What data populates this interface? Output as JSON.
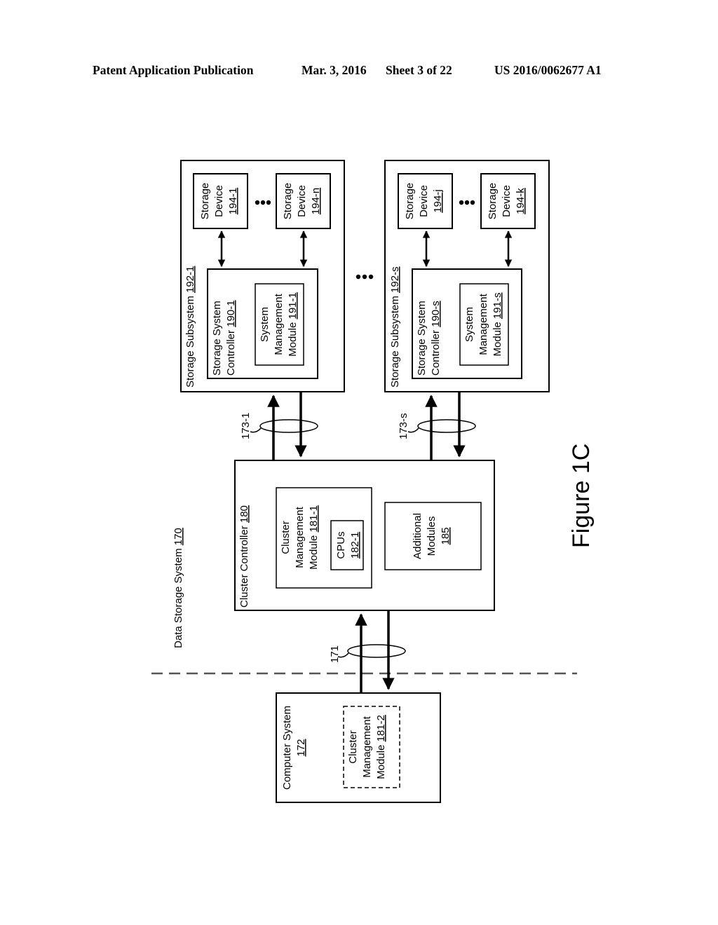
{
  "header": {
    "publication": "Patent Application Publication",
    "date": "Mar. 3, 2016",
    "sheet": "Sheet 3 of 22",
    "number": "US 2016/0062677 A1"
  },
  "figure_label": "Figure 1C",
  "system": {
    "label": "Data Storage System ",
    "ref": "170"
  },
  "subsystems": [
    {
      "label": "Storage Subsystem ",
      "ref": "192-1",
      "controller": {
        "line1": "Storage System",
        "line2": "Controller ",
        "ref": "190-1"
      },
      "module": {
        "line1": "System",
        "line2": "Management",
        "line3": "Module ",
        "ref": "191-1"
      },
      "devices": [
        {
          "line1": "Storage",
          "line2": "Device",
          "ref": "194-1"
        },
        {
          "line1": "Storage",
          "line2": "Device",
          "ref": "194-n"
        }
      ],
      "link": "173-1"
    },
    {
      "label": "Storage Subsystem ",
      "ref": "192-s",
      "controller": {
        "line1": "Storage System",
        "line2": "Controller ",
        "ref": "190-s"
      },
      "module": {
        "line1": "System",
        "line2": "Management",
        "line3": "Module ",
        "ref": "191-s"
      },
      "devices": [
        {
          "line1": "Storage",
          "line2": "Device",
          "ref": "194-j"
        },
        {
          "line1": "Storage",
          "line2": "Device",
          "ref": "194-k"
        }
      ],
      "link": "173-s"
    }
  ],
  "cluster_controller": {
    "label": "Cluster Controller ",
    "ref": "180",
    "mgmt": {
      "line1": "Cluster",
      "line2": "Management",
      "line3": "Module ",
      "ref": "181-1"
    },
    "cpus": {
      "line1": "CPUs",
      "ref": "182-1"
    },
    "additional": {
      "line1": "Additional",
      "line2": "Modules",
      "ref": "185"
    }
  },
  "computer_system": {
    "line1": "Computer System",
    "ref": "172",
    "mgmt": {
      "line1": "Cluster",
      "line2": "Management",
      "line3": "Module ",
      "ref": "181-2"
    },
    "link": "171"
  }
}
